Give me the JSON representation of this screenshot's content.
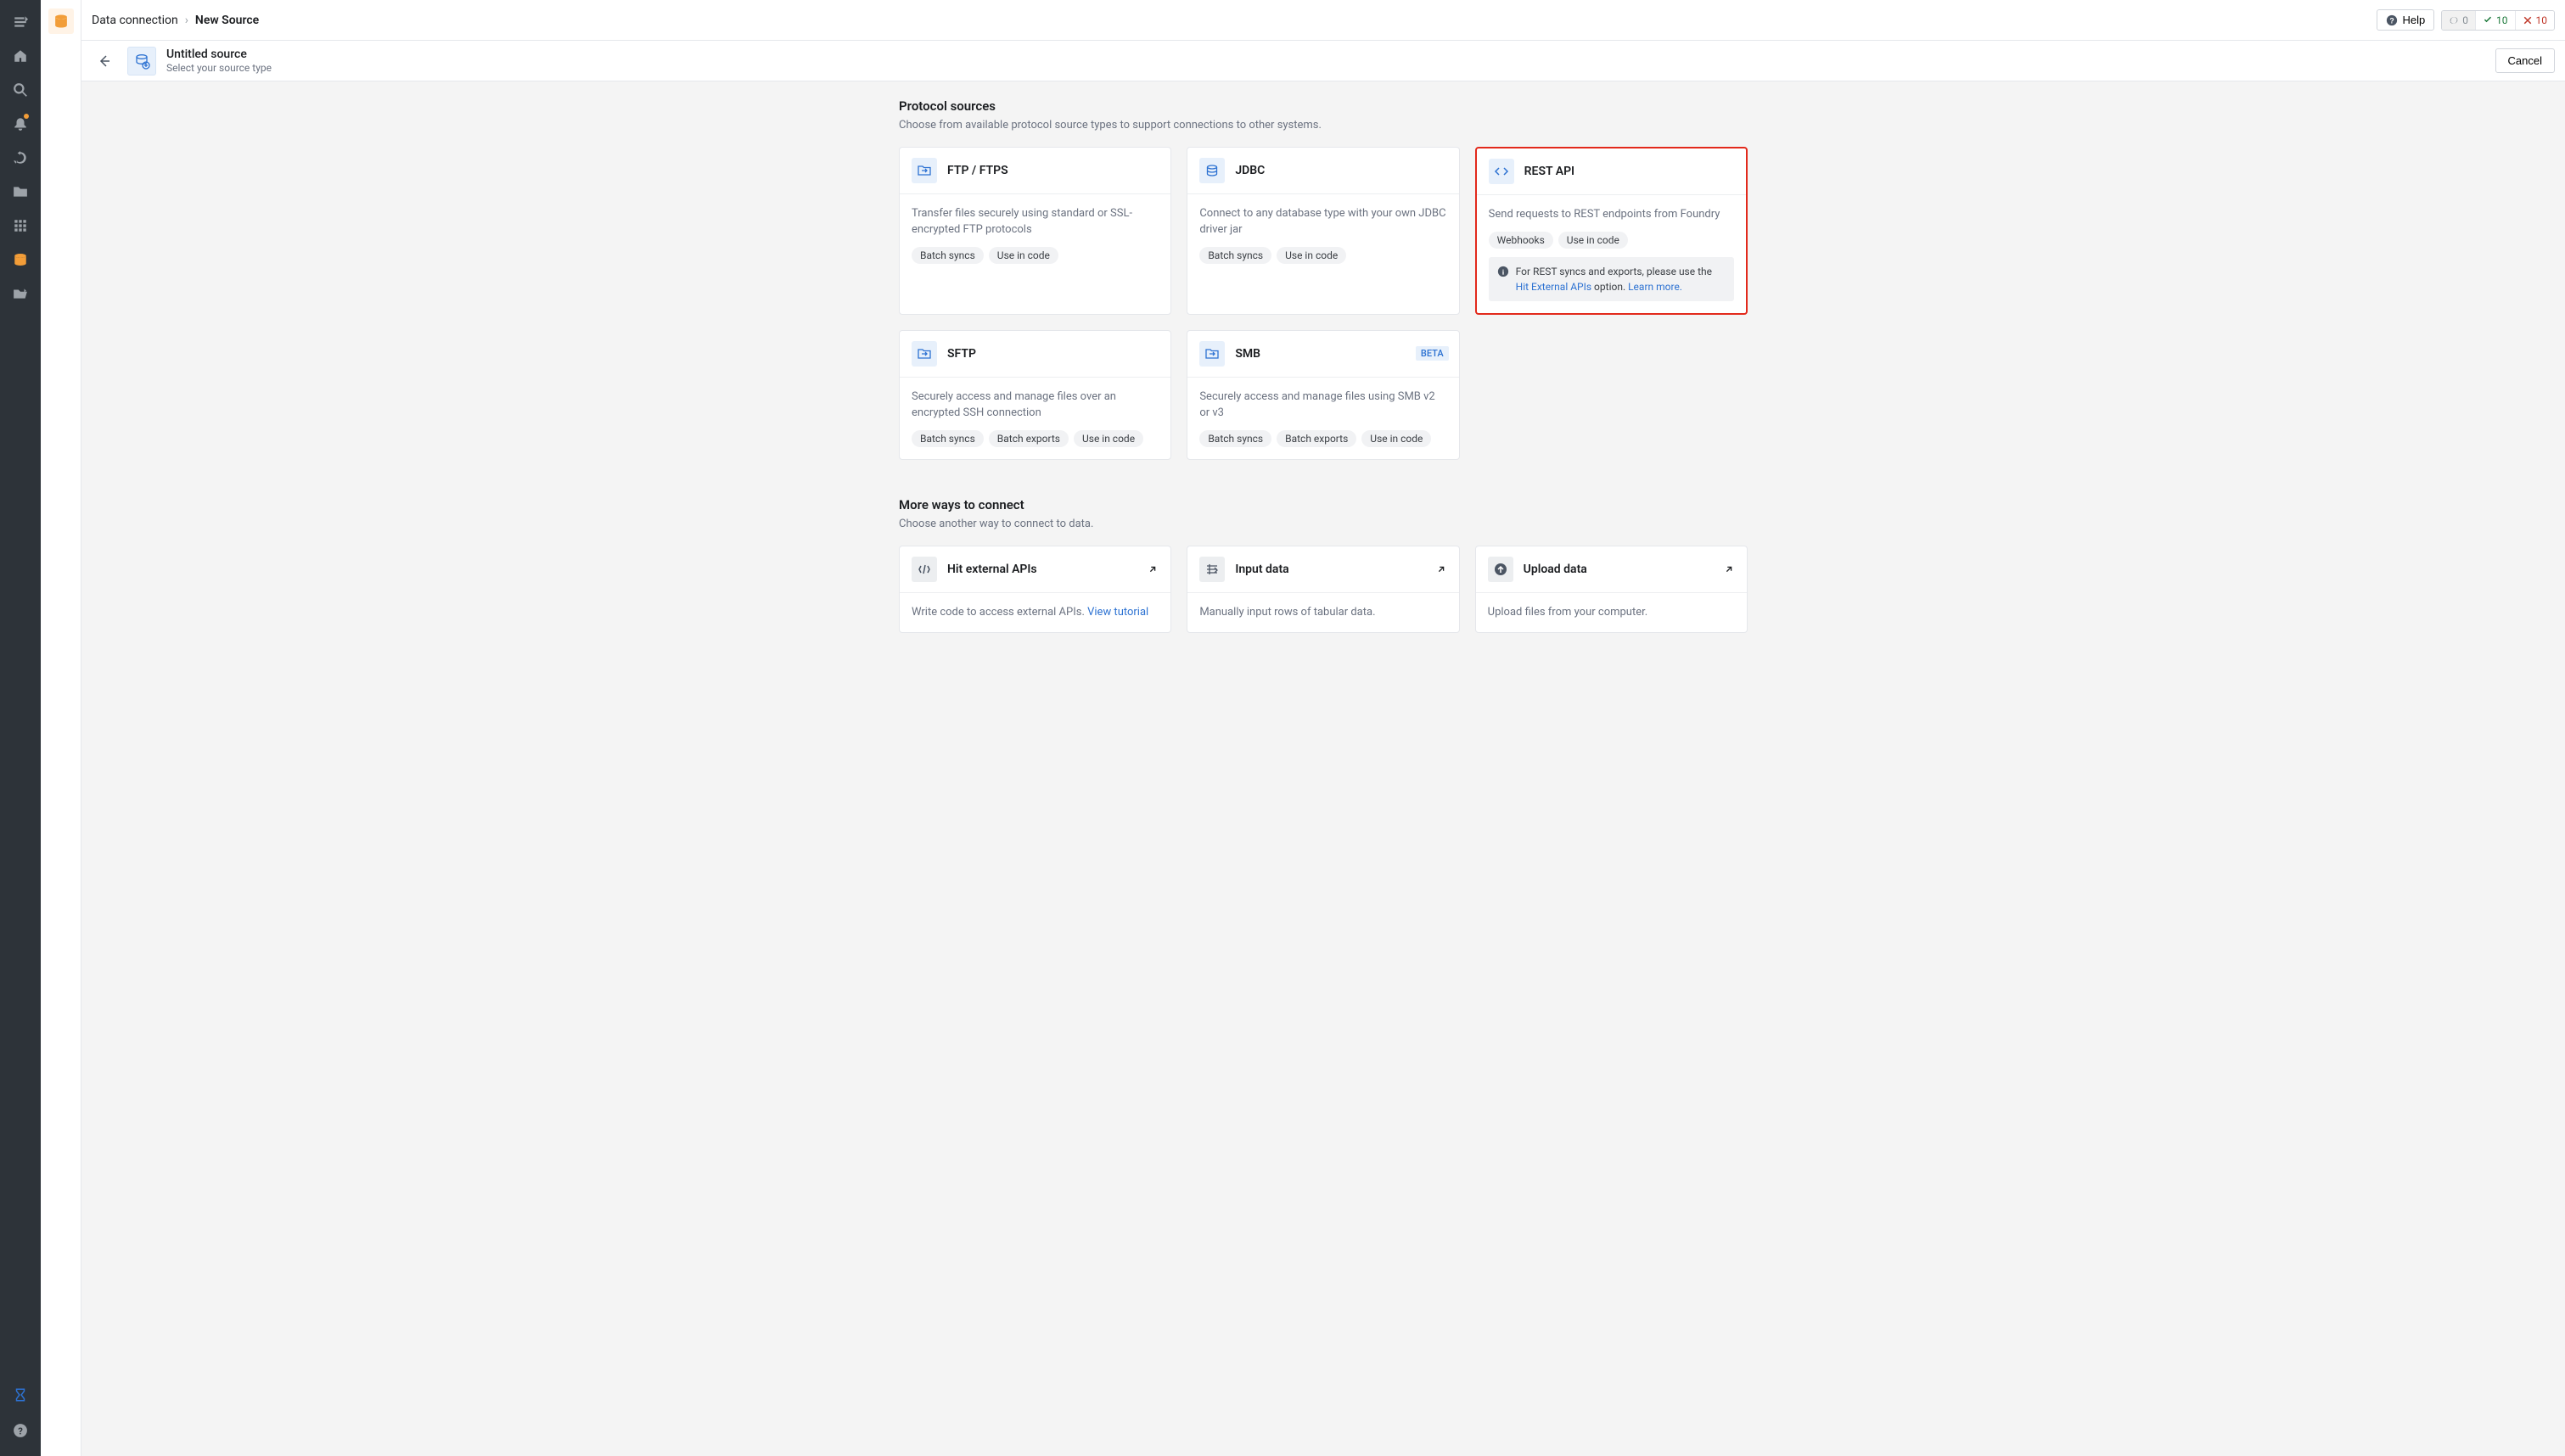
{
  "breadcrumb": {
    "parent": "Data connection",
    "current": "New Source"
  },
  "help_label": "Help",
  "status": {
    "sync": "0",
    "ok": "10",
    "err": "10"
  },
  "subheader": {
    "title": "Untitled source",
    "subtitle": "Select your source type",
    "cancel": "Cancel"
  },
  "protocol": {
    "title": "Protocol sources",
    "desc": "Choose from available protocol source types to support connections to other systems.",
    "cards": [
      {
        "title": "FTP / FTPS",
        "desc": "Transfer files securely using standard or SSL-encrypted FTP protocols",
        "tags": [
          "Batch syncs",
          "Use in code"
        ]
      },
      {
        "title": "JDBC",
        "desc": "Connect to any database type with your own JDBC driver jar",
        "tags": [
          "Batch syncs",
          "Use in code"
        ]
      },
      {
        "title": "REST API",
        "desc": "Send requests to REST endpoints from Foundry",
        "tags": [
          "Webhooks",
          "Use in code"
        ],
        "info_prefix": "For REST syncs and exports, please use the ",
        "info_link1": "Hit External APIs",
        "info_mid": " option. ",
        "info_link2": "Learn more."
      },
      {
        "title": "SFTP",
        "desc": "Securely access and manage files over an encrypted SSH connection",
        "tags": [
          "Batch syncs",
          "Batch exports",
          "Use in code"
        ]
      },
      {
        "title": "SMB",
        "desc": "Securely access and manage files using SMB v2 or v3",
        "tags": [
          "Batch syncs",
          "Batch exports",
          "Use in code"
        ],
        "beta": "BETA"
      }
    ]
  },
  "more": {
    "title": "More ways to connect",
    "desc": "Choose another way to connect to data.",
    "cards": [
      {
        "title": "Hit external APIs",
        "desc_prefix": "Write code to access external APIs. ",
        "link": "View tutorial"
      },
      {
        "title": "Input data",
        "desc": "Manually input rows of tabular data."
      },
      {
        "title": "Upload data",
        "desc": "Upload files from your computer."
      }
    ]
  }
}
